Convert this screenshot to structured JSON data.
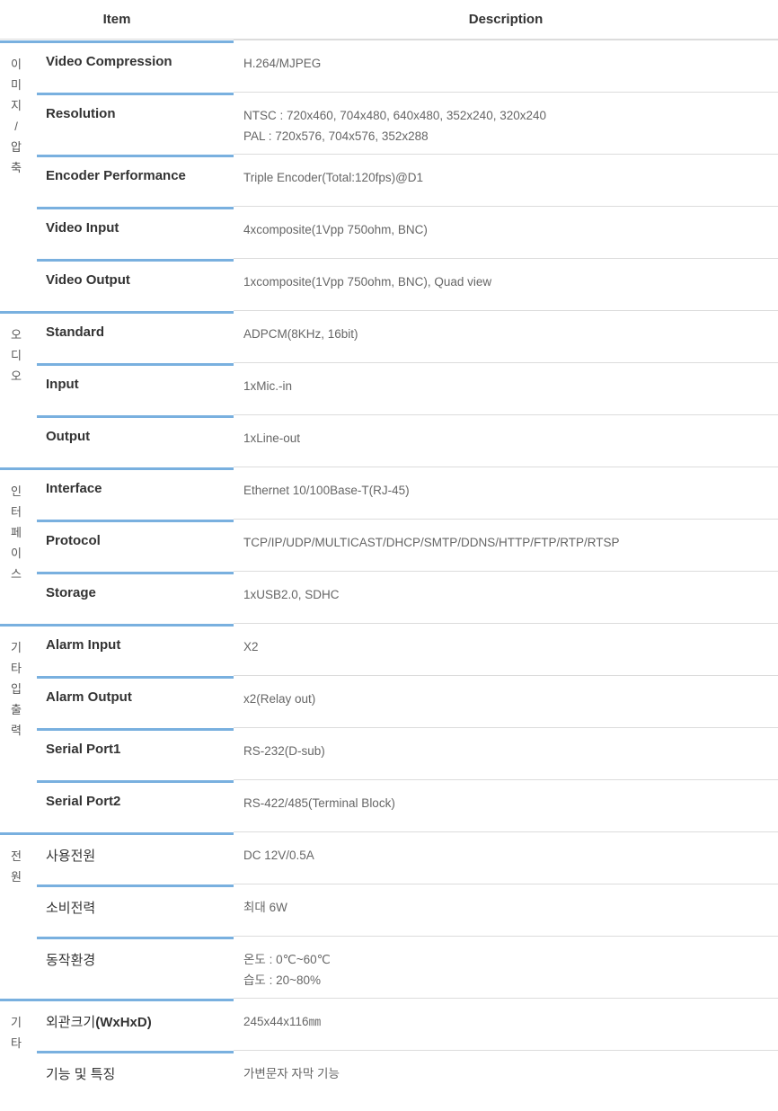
{
  "header": {
    "item": "Item",
    "description": "Description"
  },
  "groups": [
    {
      "category": [
        "이",
        "미",
        "지",
        "/",
        "압",
        "축"
      ],
      "rows": [
        {
          "item": "Video Compression",
          "desc": [
            "H.264/MJPEG"
          ]
        },
        {
          "item": "Resolution",
          "desc": [
            "NTSC : 720x460, 704x480, 640x480, 352x240, 320x240",
            "PAL : 720x576, 704x576, 352x288"
          ]
        },
        {
          "item": "Encoder Performance",
          "desc": [
            "Triple Encoder(Total:120fps)@D1"
          ]
        },
        {
          "item": "Video Input",
          "desc": [
            "4xcomposite(1Vpp 750ohm, BNC)"
          ]
        },
        {
          "item": "Video Output",
          "desc": [
            "1xcomposite(1Vpp 750ohm, BNC), Quad view"
          ]
        }
      ]
    },
    {
      "category": [
        "오",
        "디",
        "오"
      ],
      "rows": [
        {
          "item": "Standard",
          "desc": [
            "ADPCM(8KHz, 16bit)"
          ]
        },
        {
          "item": "Input",
          "desc": [
            "1xMic.-in"
          ]
        },
        {
          "item": "Output",
          "desc": [
            "1xLine-out"
          ]
        }
      ]
    },
    {
      "category": [
        "인",
        "터",
        "페",
        "이",
        "스"
      ],
      "rows": [
        {
          "item": "Interface",
          "desc": [
            "Ethernet 10/100Base-T(RJ-45)"
          ]
        },
        {
          "item": "Protocol",
          "desc": [
            "TCP/IP/UDP/MULTICAST/DHCP/SMTP/DDNS/HTTP/FTP/RTP/RTSP"
          ]
        },
        {
          "item": "Storage",
          "desc": [
            "1xUSB2.0, SDHC"
          ]
        }
      ]
    },
    {
      "category": [
        "기",
        "타",
        "입",
        "출",
        "력"
      ],
      "rows": [
        {
          "item": "Alarm Input",
          "desc": [
            "X2"
          ]
        },
        {
          "item": "Alarm Output",
          "desc": [
            "x2(Relay out)"
          ]
        },
        {
          "item": "Serial Port1",
          "desc": [
            "RS-232(D-sub)"
          ]
        },
        {
          "item": "Serial Port2",
          "desc": [
            "RS-422/485(Terminal Block)"
          ]
        }
      ]
    },
    {
      "category": [
        "전",
        "원"
      ],
      "rows": [
        {
          "item": "사용전원",
          "desc": [
            "DC 12V/0.5A"
          ]
        },
        {
          "item": "소비전력",
          "desc": [
            "최대 6W"
          ]
        },
        {
          "item": "동작환경",
          "desc": [
            "온도 : 0℃~60℃",
            "습도 : 20~80%"
          ]
        }
      ]
    },
    {
      "category": [
        "기",
        "타"
      ],
      "rows": [
        {
          "item": "외관크기(WxHxD)",
          "bold_part": "(WxHxD)",
          "desc": [
            "245x44x116㎜"
          ]
        },
        {
          "item": "기능 및 특징",
          "desc": [
            "가변문자 자막 기능"
          ]
        }
      ]
    }
  ]
}
